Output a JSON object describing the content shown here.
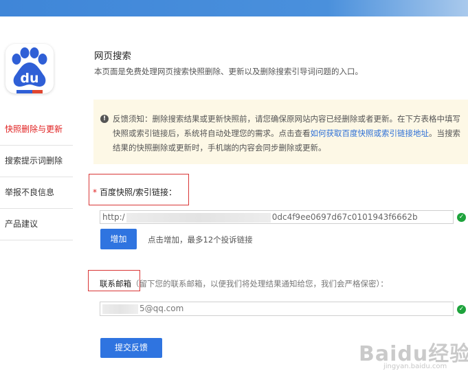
{
  "header": {
    "title": "网页搜索",
    "description": "本页面是免费处理网页搜索快照删除、更新以及删除搜索引导词问题的入口。"
  },
  "logo": {
    "text": "du"
  },
  "sidebar": {
    "items": [
      {
        "label": "快照删除与更新",
        "active": true
      },
      {
        "label": "搜索提示词删除",
        "active": false
      },
      {
        "label": "举报不良信息",
        "active": false
      },
      {
        "label": "产品建议",
        "active": false
      }
    ]
  },
  "notice": {
    "icon": "exclamation-icon",
    "text_before": "反馈须知：删除搜索结果或更新快照前，请您确保原网站内容已经删除或者更新。在下方表格中填写快照或索引链接后，系统将自动处理您的需求。点击查看",
    "link_text": "如何获取百度快照或索引链接地址",
    "text_after": "。当搜索结果的快照删除或更新时，手机端的内容会同步删除或更新。"
  },
  "url_field": {
    "required_mark": "*",
    "label": "百度快照/索引链接：",
    "value_prefix": "http:/",
    "value_suffix": "0dc4f9ee0697d67c0101943f6662b"
  },
  "add_button": {
    "label": "增加"
  },
  "add_hint": "点击增加，最多12个投诉链接",
  "email_field": {
    "label": "联系邮箱",
    "note": "（留下您的联系邮箱，以便我们将处理结果通知给您，我们会严格保密）：",
    "value_suffix": "5@qq.com"
  },
  "submit_button": {
    "label": "提交反馈"
  },
  "watermark": {
    "main": "Baidu经验",
    "sub": "jingyan.baidu.com"
  },
  "colors": {
    "accent": "#2f74e0",
    "active_nav": "#e02020",
    "notice_bg": "#fdf8e6",
    "valid_check": "#1ea33c",
    "highlight_box": "#d93535"
  }
}
